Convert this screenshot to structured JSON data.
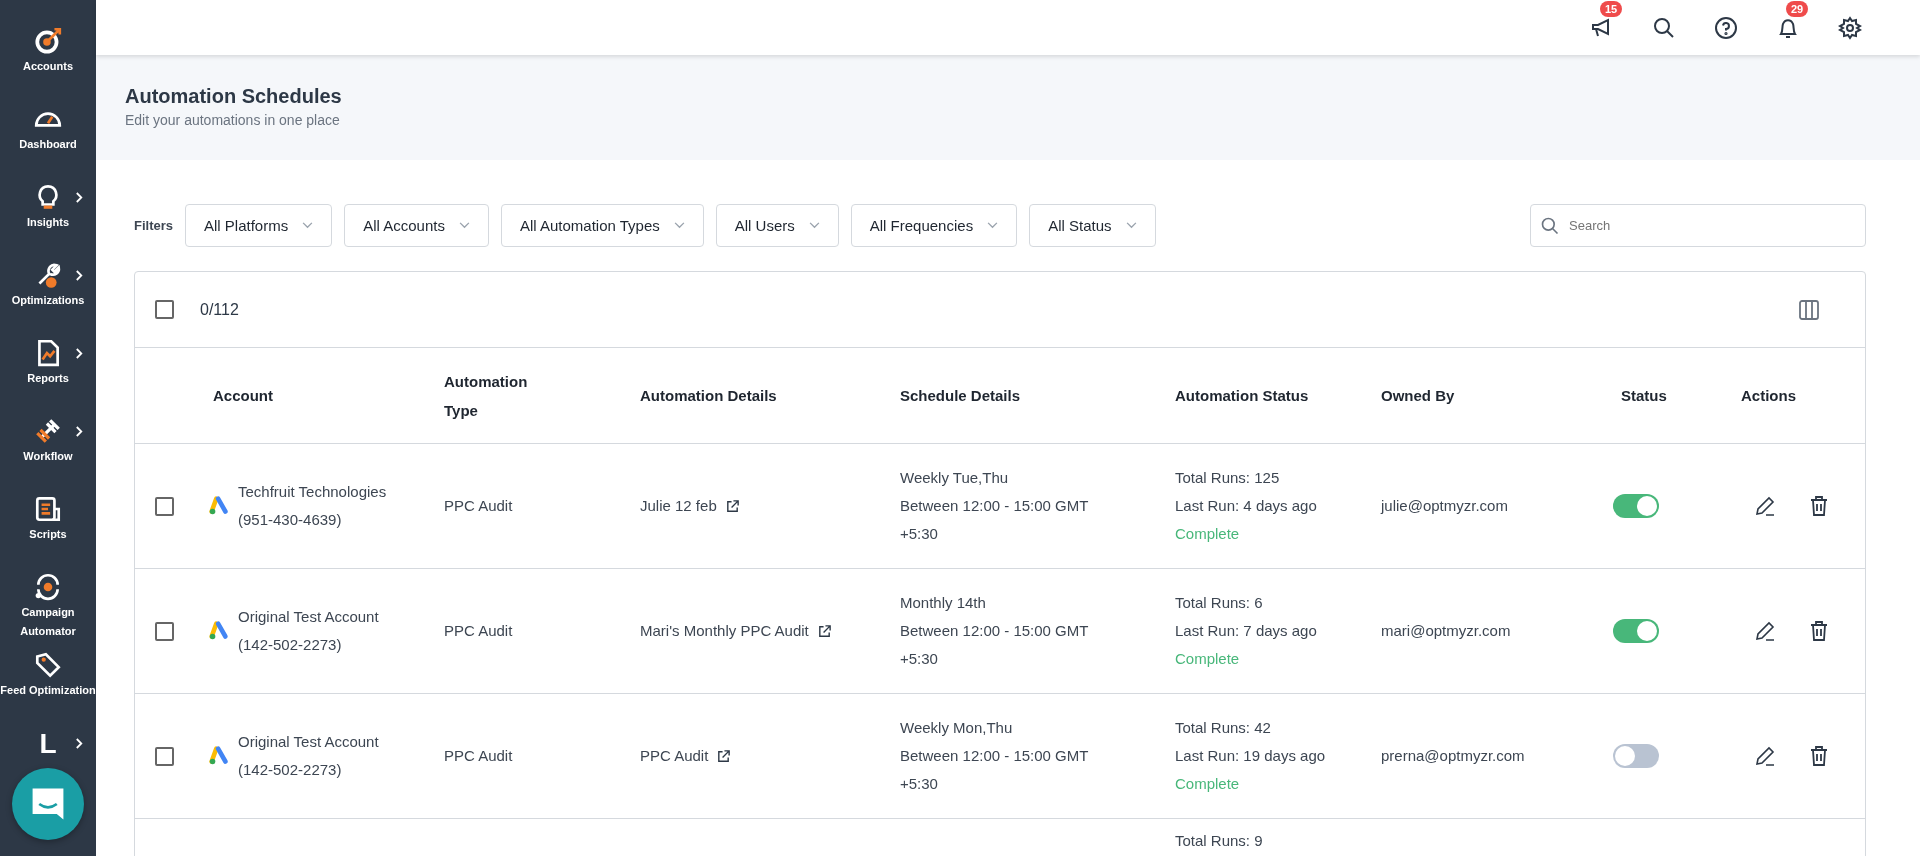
{
  "sidebar": {
    "items": [
      {
        "kind": "icon",
        "label": "Accounts",
        "has_submenu": false
      },
      {
        "kind": "icon",
        "label": "Dashboard",
        "has_submenu": false
      },
      {
        "kind": "icon",
        "label": "Insights",
        "has_submenu": true
      },
      {
        "kind": "icon",
        "label": "Optimizations",
        "has_submenu": true
      },
      {
        "kind": "icon",
        "label": "Reports",
        "has_submenu": true
      },
      {
        "kind": "icon",
        "label": "Workflow",
        "has_submenu": true
      },
      {
        "kind": "icon",
        "label": "Scripts",
        "has_submenu": false
      },
      {
        "kind": "icon",
        "label": "Campaign Automator",
        "has_submenu": false
      },
      {
        "kind": "icon",
        "label": "Feed Optimization",
        "has_submenu": false
      },
      {
        "kind": "letter",
        "label": "L",
        "has_submenu": true
      }
    ]
  },
  "topbar": {
    "icons": [
      {
        "kind": "megaphone",
        "badge": "15"
      },
      {
        "kind": "search"
      },
      {
        "kind": "help"
      },
      {
        "kind": "bell",
        "badge": "29"
      },
      {
        "kind": "settings"
      }
    ]
  },
  "header": {
    "title": "Automation Schedules",
    "subtitle": "Edit your automations in one place"
  },
  "filters": {
    "label": "Filters",
    "dropdowns": [
      "All Platforms",
      "All Accounts",
      "All Automation Types",
      "All Users",
      "All Frequencies",
      "All Status"
    ],
    "search": {
      "placeholder": "Search"
    }
  },
  "table": {
    "select_all": {
      "checked": false
    },
    "count": "0/112",
    "columns": [
      "Account",
      "Automation Type",
      "Automation Details",
      "Schedule Details",
      "Automation Status",
      "Owned By",
      "Status",
      "Actions"
    ],
    "rows": [
      {
        "checked": false,
        "account": "Techfruit Technologies",
        "account_id": "(951-430-4639)",
        "type": "PPC Audit",
        "details": "Julie 12 feb",
        "frequency": "Weekly Tue,Thu",
        "window": "Between 12:00 - 15:00 GMT +5:30",
        "total_runs": "Total Runs: 125",
        "last_run": "Last Run: 4 days ago",
        "result": "Complete",
        "owner": "julie@optmyzr.com",
        "on": true
      },
      {
        "checked": false,
        "account": "Original Test Account",
        "account_id": "(142-502-2273)",
        "type": "PPC Audit",
        "details": "Mari's Monthly PPC Audit",
        "frequency": "Monthly 14th",
        "window": "Between 12:00 - 15:00 GMT +5:30",
        "total_runs": "Total Runs: 6",
        "last_run": "Last Run: 7 days ago",
        "result": "Complete",
        "owner": "mari@optmyzr.com",
        "on": true
      },
      {
        "checked": false,
        "account": "Original Test Account",
        "account_id": "(142-502-2273)",
        "type": "PPC Audit",
        "details": "PPC Audit",
        "frequency": "Weekly Mon,Thu",
        "window": "Between 12:00 - 15:00 GMT +5:30",
        "total_runs": "Total Runs: 42",
        "last_run": "Last Run: 19 days ago",
        "result": "Complete",
        "owner": "prerna@optmyzr.com",
        "on": false
      }
    ],
    "partial_row": {
      "total_runs": "Total Runs: 9"
    }
  }
}
